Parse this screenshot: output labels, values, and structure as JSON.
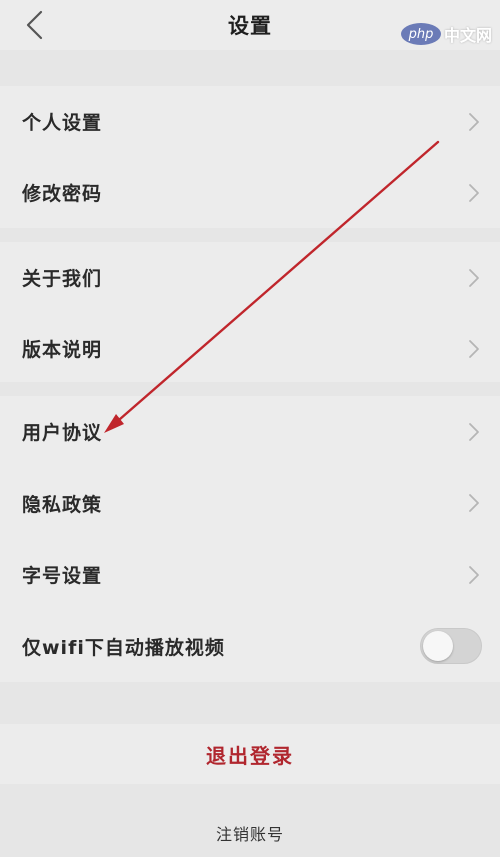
{
  "header": {
    "title": "设置",
    "back_icon": "chevron-left-icon"
  },
  "watermark": {
    "logo_text": "php",
    "site_text": "中文网"
  },
  "groups": [
    {
      "items": [
        {
          "label": "个人设置",
          "icon": "chevron-right-icon"
        },
        {
          "label": "修改密码",
          "icon": "chevron-right-icon"
        }
      ]
    },
    {
      "items": [
        {
          "label": "关于我们",
          "icon": "chevron-right-icon"
        },
        {
          "label": "版本说明",
          "icon": "chevron-right-icon"
        }
      ]
    },
    {
      "items": [
        {
          "label": "用户协议",
          "icon": "chevron-right-icon"
        },
        {
          "label": "隐私政策",
          "icon": "chevron-right-icon"
        },
        {
          "label": "字号设置",
          "icon": "chevron-right-icon"
        }
      ]
    }
  ],
  "autoplay": {
    "label": "仅wifi下自动播放视频",
    "enabled": false
  },
  "actions": {
    "logout_label": "退出登录",
    "deregister_label": "注销账号"
  },
  "colors": {
    "logout_text": "#b0262e",
    "annotation_arrow": "#c0262c",
    "background": "#e6e6e6",
    "row_background": "#ececec"
  }
}
